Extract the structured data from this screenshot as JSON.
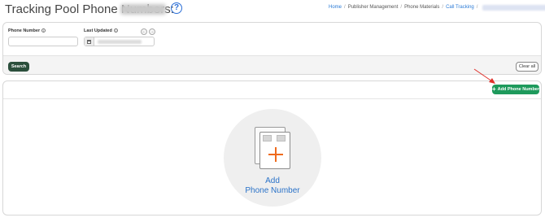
{
  "header": {
    "title": "Tracking Pool Phone Numbers:",
    "help_symbol": "?"
  },
  "breadcrumb": {
    "items": [
      "Home",
      "Publisher Management",
      "Phone Materials",
      "Call Tracking"
    ],
    "separator": "/"
  },
  "filters": {
    "phone_number_label": "Phone Number",
    "phone_number_value": "",
    "last_updated_label": "Last Updated",
    "info_symbol": "i",
    "prev_symbol": "←",
    "next_symbol": "→",
    "search_label": "Search",
    "clear_label": "Clear all"
  },
  "main": {
    "add_button_label": "Add Phone Number",
    "add_button_icon": "plus-icon",
    "empty_title_line1": "Add",
    "empty_title_line2": "Phone Number"
  },
  "colors": {
    "search_button": "#2b4f3c",
    "add_button": "#1e9a5c",
    "link": "#2a7ad6",
    "accent_plus": "#ef6a1c",
    "annotation_arrow": "#e0312b"
  }
}
